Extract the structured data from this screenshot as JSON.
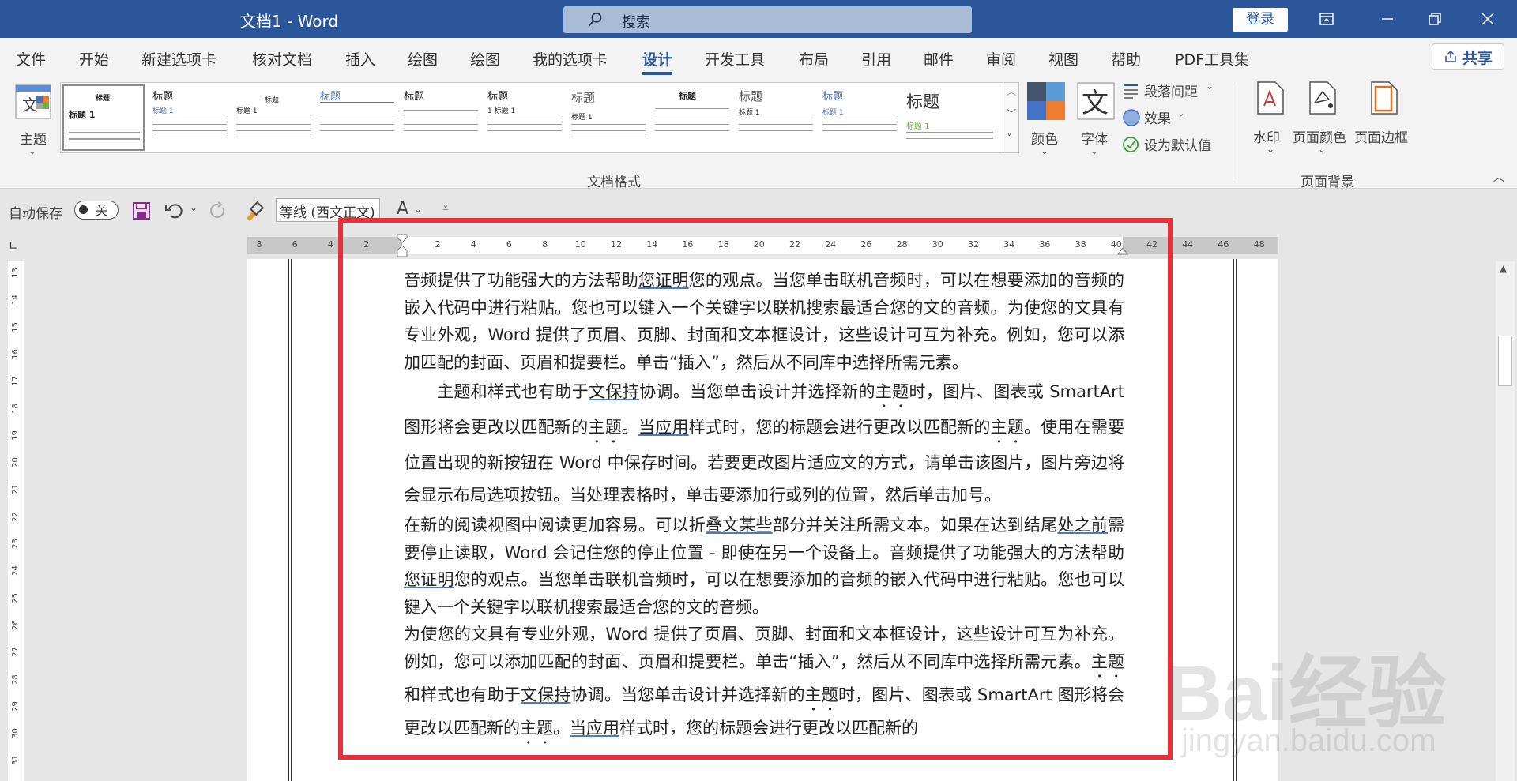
{
  "titlebar": {
    "doc_title": "文档1  -  Word",
    "search_label": "搜索",
    "login": "登录"
  },
  "tabs": [
    "文件",
    "开始",
    "新建选项卡",
    "核对文档",
    "插入",
    "绘图",
    "绘图",
    "我的选项卡",
    "设计",
    "开发工具",
    "布局",
    "引用",
    "邮件",
    "审阅",
    "视图",
    "帮助",
    "PDF工具集"
  ],
  "active_tab": "设计",
  "share": "共享",
  "ribbon": {
    "theme": "主题",
    "gallery_group": "文档格式",
    "gallery_items": [
      {
        "title": "标题",
        "heading": "标题 1"
      },
      {
        "title": "标题",
        "heading": "标题 1"
      },
      {
        "title": "标题",
        "heading": "标题 1"
      },
      {
        "title": "标题",
        "heading": ""
      },
      {
        "title": "标题",
        "heading": ""
      },
      {
        "title": "标题",
        "heading": "1 标题 1"
      },
      {
        "title": "标题",
        "heading": "标题 1"
      },
      {
        "title": "标题",
        "heading": ""
      },
      {
        "title": "标题",
        "heading": "标题 1"
      },
      {
        "title": "标题",
        "heading": "标题 1"
      },
      {
        "title": "标题",
        "heading": "标题 1"
      }
    ],
    "colors": "颜色",
    "fonts": "字体",
    "paragraph_spacing": "段落间距",
    "effects": "效果",
    "set_default": "设为默认值",
    "watermark": "水印",
    "page_color": "页面颜色",
    "page_border": "页面边框",
    "page_background_group": "页面背景"
  },
  "qat": {
    "autosave": "自动保存",
    "toggle": "关",
    "font": "等线 (西文正文)"
  },
  "ruler_numbers": [
    "8",
    "6",
    "4",
    "2",
    "",
    "2",
    "4",
    "6",
    "8",
    "10",
    "12",
    "14",
    "16",
    "18",
    "20",
    "22",
    "24",
    "26",
    "28",
    "30",
    "32",
    "34",
    "36",
    "38",
    "40",
    "42",
    "44",
    "46",
    "48"
  ],
  "vruler_numbers": [
    "13",
    "14",
    "15",
    "16",
    "17",
    "18",
    "19",
    "20",
    "21",
    "22",
    "23",
    "24",
    "25",
    "26",
    "27",
    "28",
    "29",
    "30",
    "31"
  ],
  "document": {
    "p1_a": "音频提供了功能强大的方法帮助",
    "p1_u1": "您证明",
    "p1_b": "您的观点。当您单击联机音频时，可以在想要添加的音频的嵌入代码中进行粘贴。您也可以键入一个关键字以联机搜索最适合您的文的音频。为使您的文具有专业外观，Word 提供了页眉、页脚、封面和文本框设计，这些设计可互为补充。例如，您可以添加匹配的封面、页眉和提要栏。单击“插入”，然后从不同库中选择所需元素。",
    "p2_a": "主题和样式也有助于",
    "p2_u1": "文保持",
    "p2_b": "协调。当您单击设计并选择新的",
    "p2_d1": "主题",
    "p2_c": "时，图片、图表或 SmartArt 图形将会更改以匹配新的",
    "p2_d2": "主题",
    "p2_d": "。",
    "p2_u2": "当应用",
    "p2_e": "样式时，您的标题会进行更改以匹配新的",
    "p2_d3": "主题",
    "p2_f": "。使用在需要位置出现的新按钮在 Word 中保存时间。若要更改图片适应文的方式，请单击该图片，图片旁边将会显示布局选项按钮。当处理表格时，单击要添加行或列的位置，然后单击加号。",
    "p3_a": "在新的阅读视图中阅读更加容易。可以折",
    "p3_u1": "叠文某些",
    "p3_b": "部分并关注所需文本。如果在达到结尾",
    "p3_u2": "处之前",
    "p3_c": "需要停止读取，Word 会记住您的停止位置 - 即使在另一个设备上。音频提供了功能强大的方法帮助",
    "p3_u3": "您证明",
    "p3_d": "您的观点。当您单击联机音频时，可以在想要添加的音频的嵌入代码中进行粘贴。您也可以键入一个关键字以联机搜索最适合您的文的音频。",
    "p4_a": "为使您的文具有专业外观，Word 提供了页眉、页脚、封面和文本框设计，这些设计可互为补充。例如，您可以添加匹配的封面、页眉和提要栏。单击“插入”，然后从不同库中选择所需元素。",
    "p4_d1": "主题",
    "p4_b": "和样式也有助于",
    "p4_u1": "文保持",
    "p4_c": "协调。当您单击设计并选择新的",
    "p4_d2": "主题",
    "p4_d": "时，图片、图表或 SmartArt 图形将会更改以匹配新的",
    "p4_d3": "主题",
    "p4_e": "。",
    "p4_u2": "当应用",
    "p4_f": "样式时，您的标题会进行更改以匹配新的"
  },
  "watermark": {
    "big": "Bai经验",
    "small": "jingyan.baidu.com"
  },
  "colors": {
    "accent": "#2b579a",
    "highlight": "#e8303a"
  }
}
